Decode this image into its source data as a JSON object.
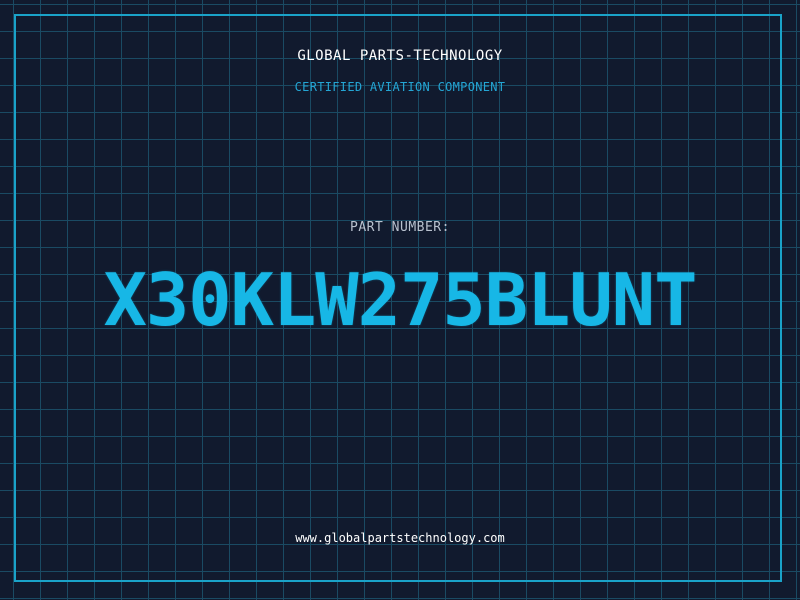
{
  "header": {
    "brand": "GLOBAL PARTS-TECHNOLOGY",
    "subtitle": "CERTIFIED AVIATION COMPONENT"
  },
  "part": {
    "label": "PART NUMBER:",
    "number": "X30KLW275BLUNT"
  },
  "footer": {
    "url": "www.globalpartstechnology.com"
  },
  "colors": {
    "background": "#111a2e",
    "grid": "#1a4a63",
    "accent": "#17b7e6",
    "frame": "#1aa3c9"
  }
}
